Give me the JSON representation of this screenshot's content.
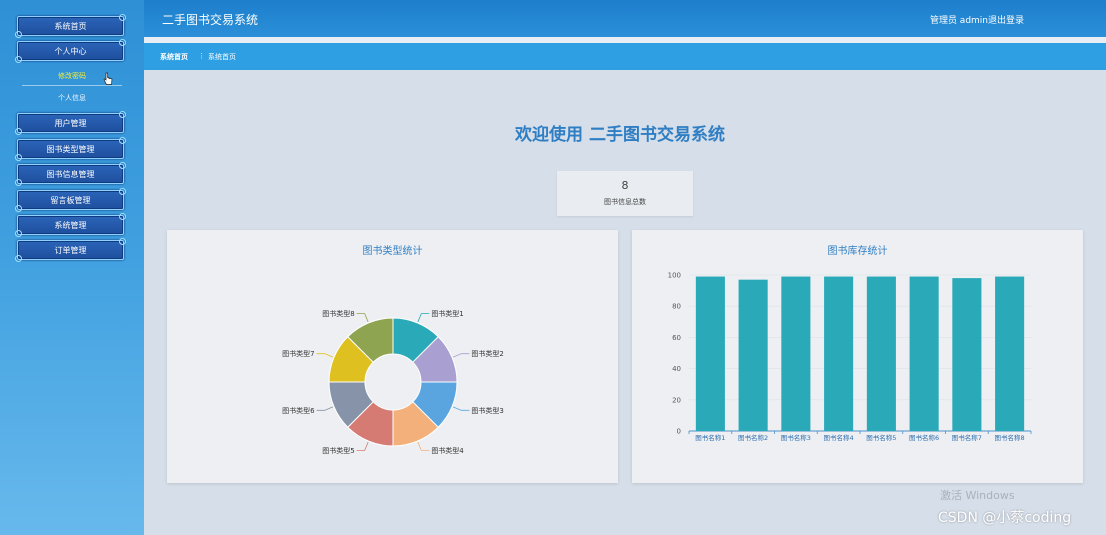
{
  "header": {
    "title": "二手图书交易系统",
    "user": "管理员 admin",
    "logout": "退出登录"
  },
  "sidebar": {
    "items": [
      {
        "label": "系统首页"
      },
      {
        "label": "个人中心"
      },
      {
        "label": "用户管理"
      },
      {
        "label": "图书类型管理"
      },
      {
        "label": "图书信息管理"
      },
      {
        "label": "留言板管理"
      },
      {
        "label": "系统管理"
      },
      {
        "label": "订单管理"
      }
    ],
    "sub_items": [
      {
        "label": "修改密码",
        "active": true
      },
      {
        "label": "个人信息",
        "active": false
      }
    ]
  },
  "breadcrumb": {
    "home": "系统首页",
    "sep": "⋮",
    "current": "系统首页"
  },
  "welcome": "欢迎使用 二手图书交易系统",
  "stat": {
    "value": "8",
    "label": "图书信息总数"
  },
  "panels": {
    "left_title": "图书类型统计",
    "right_title": "图书库存统计"
  },
  "chart_data": [
    {
      "type": "pie",
      "title": "图书类型统计",
      "categories": [
        "图书类型1",
        "图书类型2",
        "图书类型3",
        "图书类型4",
        "图书类型5",
        "图书类型6",
        "图书类型7",
        "图书类型8"
      ],
      "values": [
        1,
        1,
        1,
        1,
        1,
        1,
        1,
        1
      ],
      "colors": [
        "#2aa9b8",
        "#a99fd1",
        "#5aa5e0",
        "#f4b07b",
        "#d67a74",
        "#8793a8",
        "#dfc021",
        "#8fa451"
      ]
    },
    {
      "type": "bar",
      "title": "图书库存统计",
      "categories": [
        "图书名称1",
        "图书名称2",
        "图书名称3",
        "图书名称4",
        "图书名称5",
        "图书名称6",
        "图书名称7",
        "图书名称8"
      ],
      "values": [
        99,
        97,
        99,
        99,
        99,
        99,
        98,
        99
      ],
      "ylim": [
        0,
        100
      ],
      "yticks": [
        "0",
        "20",
        "40",
        "60",
        "80",
        "100"
      ],
      "color": "#2aa9b8"
    }
  ],
  "watermark": {
    "windows": "激活 Windows",
    "csdn": "CSDN @小蔡coding"
  }
}
